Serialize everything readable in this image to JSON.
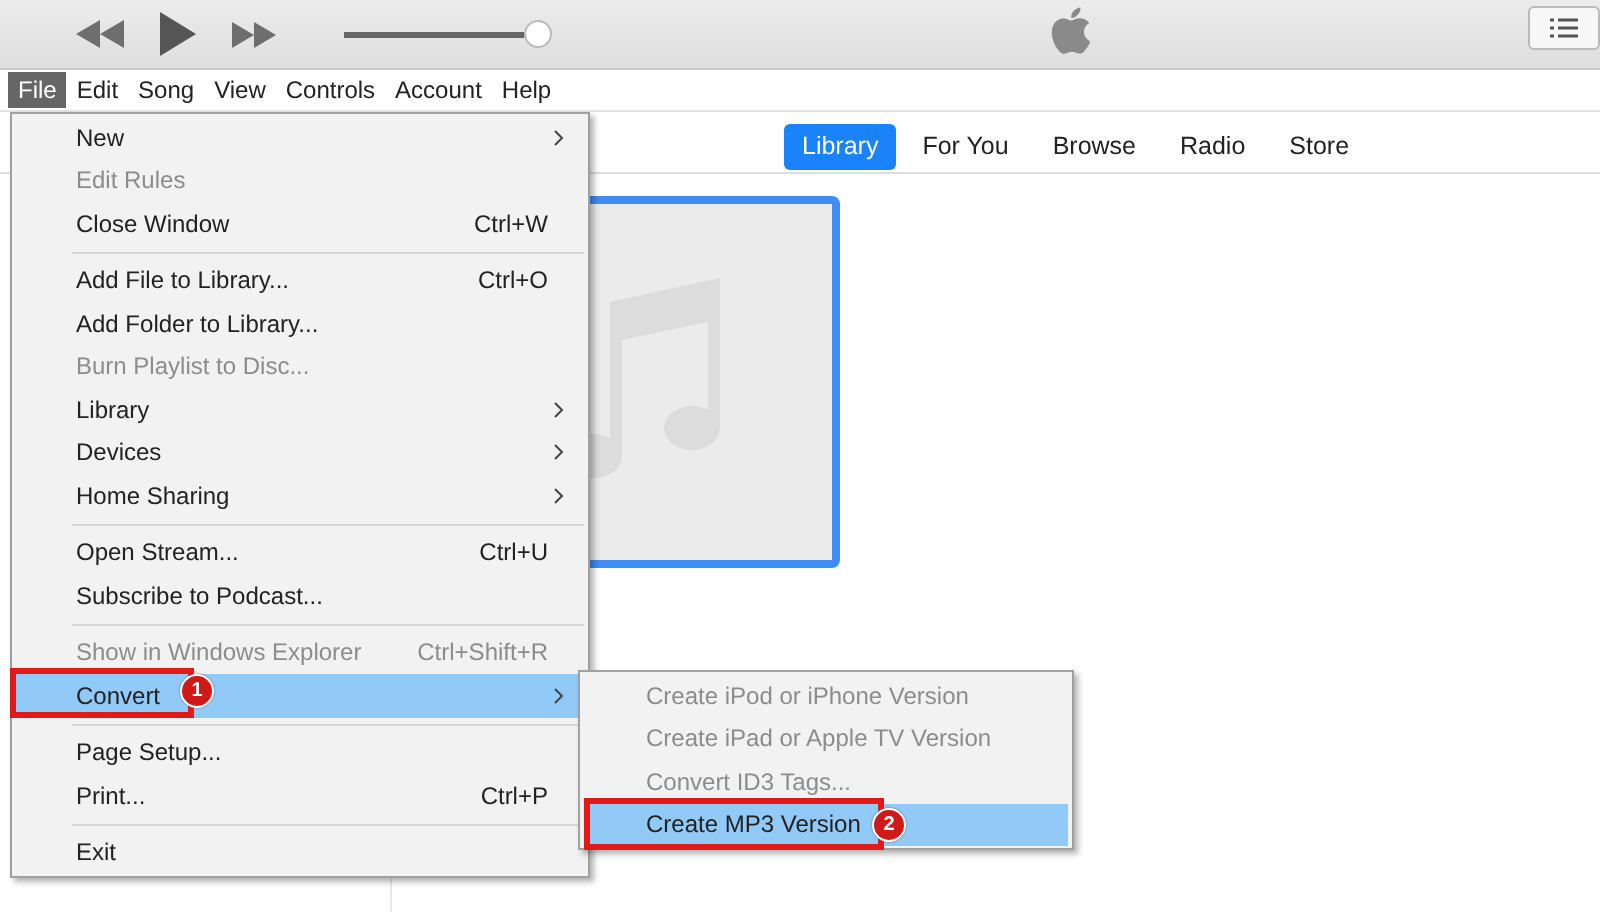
{
  "player": {
    "volume": {
      "level": 0.97
    }
  },
  "menu_bar": [
    {
      "label": "File",
      "selected": true
    },
    {
      "label": "Edit",
      "selected": false
    },
    {
      "label": "Song",
      "selected": false
    },
    {
      "label": "View",
      "selected": false
    },
    {
      "label": "Controls",
      "selected": false
    },
    {
      "label": "Account",
      "selected": false
    },
    {
      "label": "Help",
      "selected": false
    }
  ],
  "tabs": [
    {
      "label": "Library",
      "selected": true
    },
    {
      "label": "For You",
      "selected": false
    },
    {
      "label": "Browse",
      "selected": false
    },
    {
      "label": "Radio",
      "selected": false
    },
    {
      "label": "Store",
      "selected": false
    }
  ],
  "file_menu": [
    {
      "kind": "item",
      "label": "New",
      "submenu": true,
      "disabled": false,
      "selected": false
    },
    {
      "kind": "item",
      "label": "Edit Rules",
      "submenu": false,
      "disabled": true,
      "selected": false
    },
    {
      "kind": "item",
      "label": "Close Window",
      "shortcut": "Ctrl+W",
      "submenu": false,
      "disabled": false,
      "selected": false
    },
    {
      "kind": "separator"
    },
    {
      "kind": "item",
      "label": "Add File to Library...",
      "shortcut": "Ctrl+O",
      "submenu": false,
      "disabled": false,
      "selected": false
    },
    {
      "kind": "item",
      "label": "Add Folder to Library...",
      "submenu": false,
      "disabled": false,
      "selected": false
    },
    {
      "kind": "item",
      "label": "Burn Playlist to Disc...",
      "submenu": false,
      "disabled": true,
      "selected": false
    },
    {
      "kind": "item",
      "label": "Library",
      "submenu": true,
      "disabled": false,
      "selected": false
    },
    {
      "kind": "item",
      "label": "Devices",
      "submenu": true,
      "disabled": false,
      "selected": false
    },
    {
      "kind": "item",
      "label": "Home Sharing",
      "submenu": true,
      "disabled": false,
      "selected": false
    },
    {
      "kind": "separator"
    },
    {
      "kind": "item",
      "label": "Open Stream...",
      "shortcut": "Ctrl+U",
      "submenu": false,
      "disabled": false,
      "selected": false
    },
    {
      "kind": "item",
      "label": "Subscribe to Podcast...",
      "submenu": false,
      "disabled": false,
      "selected": false
    },
    {
      "kind": "separator"
    },
    {
      "kind": "item",
      "label": "Show in Windows Explorer",
      "shortcut": "Ctrl+Shift+R",
      "submenu": false,
      "disabled": true,
      "selected": false
    },
    {
      "kind": "item",
      "label": "Convert",
      "submenu": true,
      "disabled": false,
      "selected": true,
      "callout": "1"
    },
    {
      "kind": "separator"
    },
    {
      "kind": "item",
      "label": "Page Setup...",
      "submenu": false,
      "disabled": false,
      "selected": false
    },
    {
      "kind": "item",
      "label": "Print...",
      "shortcut": "Ctrl+P",
      "submenu": false,
      "disabled": false,
      "selected": false
    },
    {
      "kind": "separator"
    },
    {
      "kind": "item",
      "label": "Exit",
      "submenu": false,
      "disabled": false,
      "selected": false
    }
  ],
  "convert_submenu": [
    {
      "label": "Create iPod or iPhone Version",
      "disabled": true,
      "selected": false
    },
    {
      "label": "Create iPad or Apple TV Version",
      "disabled": true,
      "selected": false
    },
    {
      "label": "Convert ID3 Tags...",
      "disabled": true,
      "selected": false
    },
    {
      "label": "Create MP3 Version",
      "disabled": false,
      "selected": true,
      "callout": "2"
    }
  ]
}
